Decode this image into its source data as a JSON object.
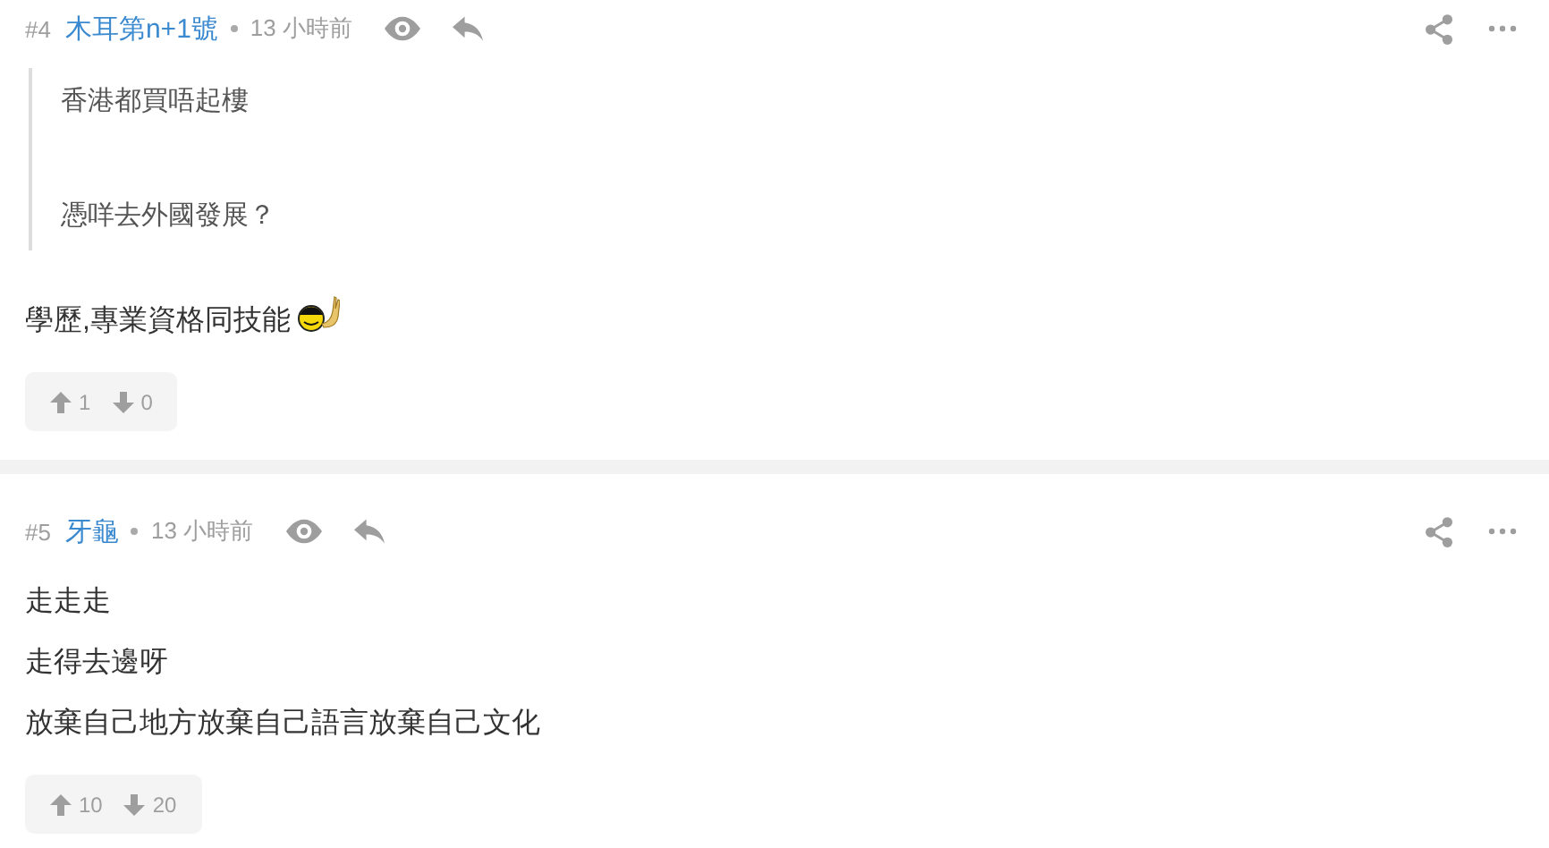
{
  "posts": [
    {
      "number": "#4",
      "author": "木耳第n+1號",
      "time": "13 小時前",
      "quote": [
        "香港都買唔起樓",
        "憑咩去外國發展？"
      ],
      "lines": [
        "學歷,專業資格同技能"
      ],
      "emoji": true,
      "upvotes": "1",
      "downvotes": "0"
    },
    {
      "number": "#5",
      "author": "牙龜",
      "time": "13 小時前",
      "lines": [
        "走走走",
        "走得去邊呀",
        "放棄自己地方放棄自己語言放棄自己文化"
      ],
      "emoji": false,
      "upvotes": "10",
      "downvotes": "20"
    }
  ]
}
